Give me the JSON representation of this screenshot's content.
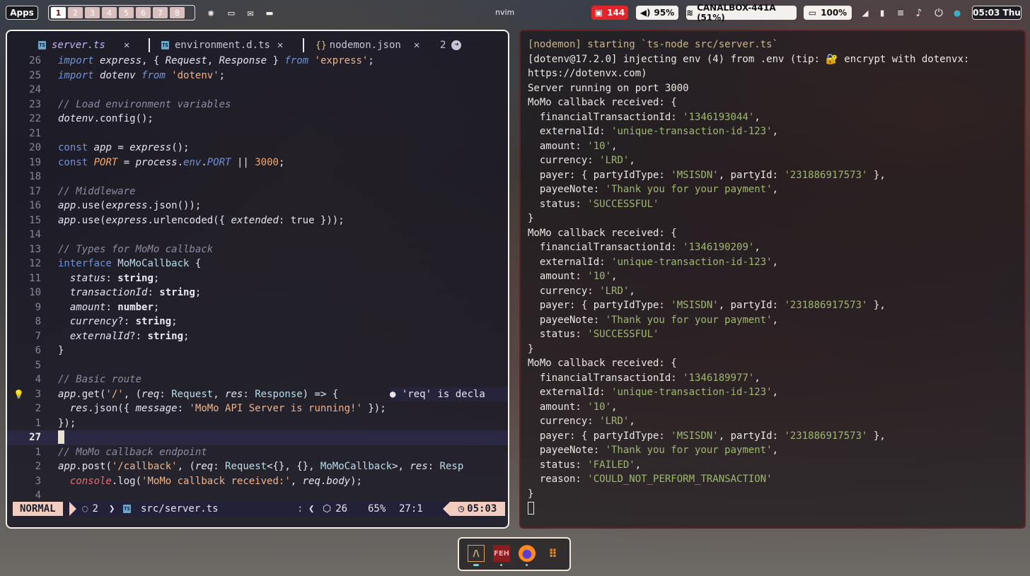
{
  "topbar": {
    "apps_label": "Apps",
    "workspaces": [
      "1",
      "2",
      "3",
      "4",
      "5",
      "6",
      "7",
      "8"
    ],
    "active_workspace": "1",
    "window_title": "nvim",
    "notifications_count": "144",
    "volume": "95%",
    "wifi": "CANALBOX-441A (51%)",
    "battery": "100%",
    "clock": "05:03 Thu"
  },
  "editor": {
    "tabs": [
      {
        "label": "server.ts",
        "close": "✕"
      },
      {
        "label": "environment.d.ts",
        "close": "✕"
      },
      {
        "label": "nodemon.json",
        "close": "✕"
      }
    ],
    "tab_count": "2",
    "virtual_text": "● 'req' is decla",
    "status": {
      "mode": "NORMAL",
      "diagnostics": "2",
      "file": "src/server.ts",
      "separator": ":",
      "lsp_count": "26",
      "percent": "65%",
      "position": "27:1",
      "clock": "05:03"
    }
  },
  "terminal": {
    "lines": [
      "[nodemon] starting `ts-node src/server.ts`",
      "[dotenv@17.2.0] injecting env (4) from .env (tip: 🔐 encrypt with dotenvx:",
      "https://dotenvx.com)",
      "Server running on port 3000",
      "MoMo callback received: {",
      "  financialTransactionId: '1346193044',",
      "  externalId: 'unique-transaction-id-123',",
      "  amount: '10',",
      "  currency: 'LRD',",
      "  payer: { partyIdType: 'MSISDN', partyId: '231886917573' },",
      "  payeeNote: 'Thank you for your payment',",
      "  status: 'SUCCESSFUL'",
      "}",
      "MoMo callback received: {",
      "  financialTransactionId: '1346190209',",
      "  externalId: 'unique-transaction-id-123',",
      "  amount: '10',",
      "  currency: 'LRD',",
      "  payer: { partyIdType: 'MSISDN', partyId: '231886917573' },",
      "  payeeNote: 'Thank you for your payment',",
      "  status: 'SUCCESSFUL'",
      "}",
      "MoMo callback received: {",
      "  financialTransactionId: '1346189977',",
      "  externalId: 'unique-transaction-id-123',",
      "  amount: '10',",
      "  currency: 'LRD',",
      "  payer: { partyIdType: 'MSISDN', partyId: '231886917573' },",
      "  payeeNote: 'Thank you for your payment',",
      "  status: 'FAILED',",
      "  reason: 'COULD_NOT_PERFORM_TRANSACTION'",
      "}"
    ]
  },
  "dock": {
    "items": [
      {
        "name": "terminal-app",
        "label": "/\\"
      },
      {
        "name": "feh-app",
        "label": "FEH"
      },
      {
        "name": "firefox-app",
        "label": ""
      },
      {
        "name": "app-grid",
        "label": ""
      }
    ]
  },
  "colors": {
    "accent": "#f2cdbf",
    "keyword": "#6f93d8",
    "string": "#efb38a",
    "terminal_string": "#9fb871",
    "red_badge": "#e0252b"
  }
}
